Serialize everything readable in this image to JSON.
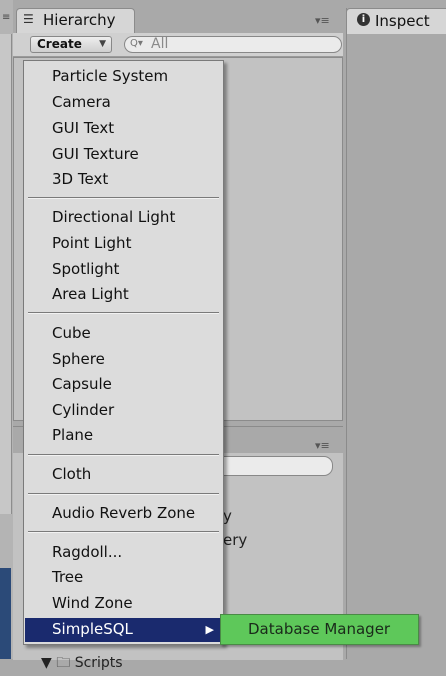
{
  "hierarchy": {
    "tab_label": "Hierarchy",
    "create_label": "Create",
    "search_placeholder": "All"
  },
  "inspector": {
    "tab_label": "Inspect"
  },
  "lower_panel": {
    "partial_text_1": "y",
    "partial_text_2": "ery",
    "folder_label": "Scripts"
  },
  "create_menu": {
    "groups": [
      [
        "Particle System",
        "Camera",
        "GUI Text",
        "GUI Texture",
        "3D Text"
      ],
      [
        "Directional Light",
        "Point Light",
        "Spotlight",
        "Area Light"
      ],
      [
        "Cube",
        "Sphere",
        "Capsule",
        "Cylinder",
        "Plane"
      ],
      [
        "Cloth"
      ],
      [
        "Audio Reverb Zone"
      ],
      [
        "Ragdoll...",
        "Tree",
        "Wind Zone",
        "SimpleSQL"
      ]
    ],
    "selected_item": "SimpleSQL",
    "submenu_item": "Database Manager"
  },
  "colors": {
    "menu_highlight": "#1a2a6e",
    "submenu_bg": "#5ec85a"
  }
}
